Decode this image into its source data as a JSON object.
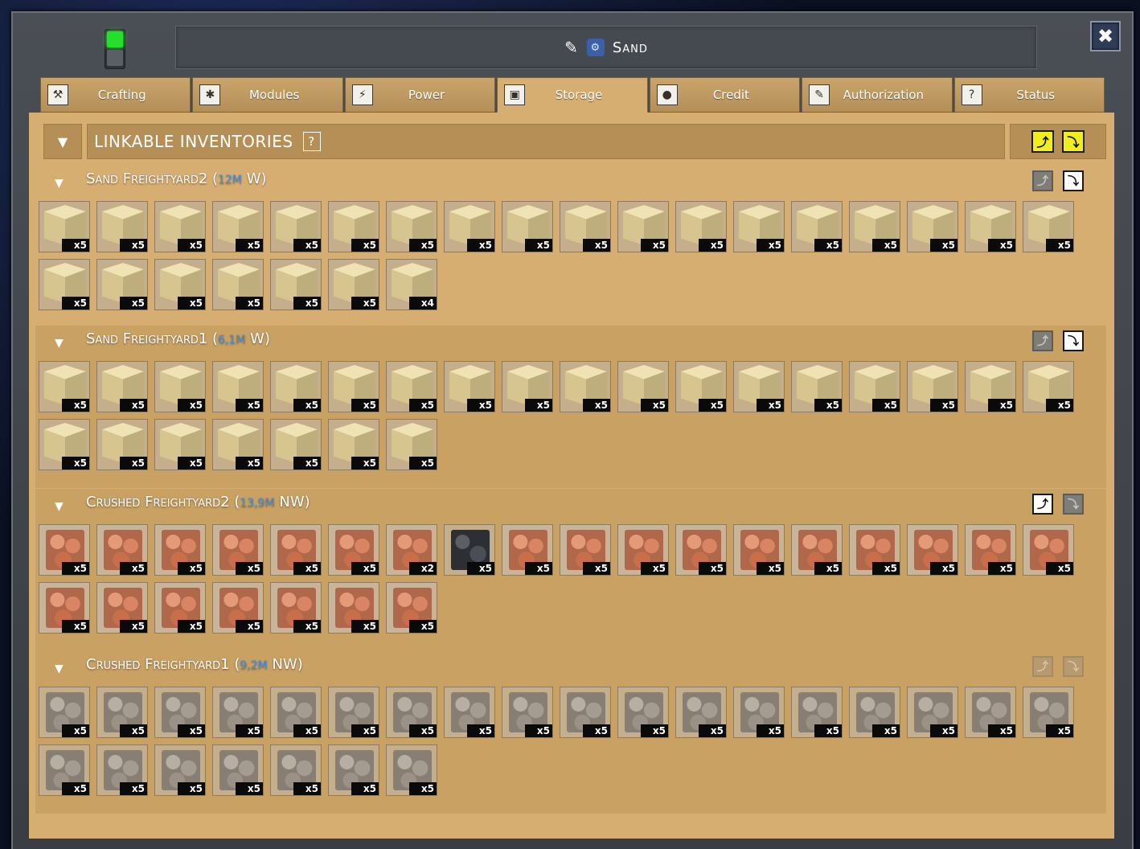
{
  "window": {
    "title": "Sand",
    "close_label": "✖"
  },
  "tabs": [
    {
      "label": "Crafting",
      "icon": "crafting-icon",
      "active": false
    },
    {
      "label": "Modules",
      "icon": "modules-icon",
      "active": false
    },
    {
      "label": "Power",
      "icon": "power-icon",
      "active": false
    },
    {
      "label": "Storage",
      "icon": "storage-icon",
      "active": true
    },
    {
      "label": "Credit",
      "icon": "credit-icon",
      "active": false
    },
    {
      "label": "Authorization",
      "icon": "authorization-icon",
      "active": false
    },
    {
      "label": "Status",
      "icon": "status-icon",
      "active": false
    }
  ],
  "linkable": {
    "title": "LINKABLE INVENTORIES",
    "help": "?"
  },
  "inventories": [
    {
      "name": "Sand Freightyard2",
      "distance": "12M",
      "direction": "W",
      "push_state": "off",
      "pull_state": "on",
      "items": [
        {
          "type": "sand",
          "count": "x5"
        },
        {
          "type": "sand",
          "count": "x5"
        },
        {
          "type": "sand",
          "count": "x5"
        },
        {
          "type": "sand",
          "count": "x5"
        },
        {
          "type": "sand",
          "count": "x5"
        },
        {
          "type": "sand",
          "count": "x5"
        },
        {
          "type": "sand",
          "count": "x5"
        },
        {
          "type": "sand",
          "count": "x5"
        },
        {
          "type": "sand",
          "count": "x5"
        },
        {
          "type": "sand",
          "count": "x5"
        },
        {
          "type": "sand",
          "count": "x5"
        },
        {
          "type": "sand",
          "count": "x5"
        },
        {
          "type": "sand",
          "count": "x5"
        },
        {
          "type": "sand",
          "count": "x5"
        },
        {
          "type": "sand",
          "count": "x5"
        },
        {
          "type": "sand",
          "count": "x5"
        },
        {
          "type": "sand",
          "count": "x5"
        },
        {
          "type": "sand",
          "count": "x5"
        },
        {
          "type": "sand",
          "count": "x5"
        },
        {
          "type": "sand",
          "count": "x5"
        },
        {
          "type": "sand",
          "count": "x5"
        },
        {
          "type": "sand",
          "count": "x5"
        },
        {
          "type": "sand",
          "count": "x5"
        },
        {
          "type": "sand",
          "count": "x5"
        },
        {
          "type": "sand",
          "count": "x4"
        }
      ]
    },
    {
      "name": "Sand Freightyard1",
      "distance": "6,1M",
      "direction": "W",
      "push_state": "off",
      "pull_state": "on",
      "items": [
        {
          "type": "sand",
          "count": "x5"
        },
        {
          "type": "sand",
          "count": "x5"
        },
        {
          "type": "sand",
          "count": "x5"
        },
        {
          "type": "sand",
          "count": "x5"
        },
        {
          "type": "sand",
          "count": "x5"
        },
        {
          "type": "sand",
          "count": "x5"
        },
        {
          "type": "sand",
          "count": "x5"
        },
        {
          "type": "sand",
          "count": "x5"
        },
        {
          "type": "sand",
          "count": "x5"
        },
        {
          "type": "sand",
          "count": "x5"
        },
        {
          "type": "sand",
          "count": "x5"
        },
        {
          "type": "sand",
          "count": "x5"
        },
        {
          "type": "sand",
          "count": "x5"
        },
        {
          "type": "sand",
          "count": "x5"
        },
        {
          "type": "sand",
          "count": "x5"
        },
        {
          "type": "sand",
          "count": "x5"
        },
        {
          "type": "sand",
          "count": "x5"
        },
        {
          "type": "sand",
          "count": "x5"
        },
        {
          "type": "sand",
          "count": "x5"
        },
        {
          "type": "sand",
          "count": "x5"
        },
        {
          "type": "sand",
          "count": "x5"
        },
        {
          "type": "sand",
          "count": "x5"
        },
        {
          "type": "sand",
          "count": "x5"
        },
        {
          "type": "sand",
          "count": "x5"
        },
        {
          "type": "sand",
          "count": "x5"
        }
      ]
    },
    {
      "name": "Crushed Freightyard2",
      "distance": "13,9M",
      "direction": "NW",
      "push_state": "on",
      "pull_state": "off",
      "items": [
        {
          "type": "copper",
          "count": "x5"
        },
        {
          "type": "copper",
          "count": "x5"
        },
        {
          "type": "copper",
          "count": "x5"
        },
        {
          "type": "copper",
          "count": "x5"
        },
        {
          "type": "copper",
          "count": "x5"
        },
        {
          "type": "copper",
          "count": "x5"
        },
        {
          "type": "copper",
          "count": "x2"
        },
        {
          "type": "dark",
          "count": "x5"
        },
        {
          "type": "copper",
          "count": "x5"
        },
        {
          "type": "copper",
          "count": "x5"
        },
        {
          "type": "copper",
          "count": "x5"
        },
        {
          "type": "copper",
          "count": "x5"
        },
        {
          "type": "copper",
          "count": "x5"
        },
        {
          "type": "copper",
          "count": "x5"
        },
        {
          "type": "copper",
          "count": "x5"
        },
        {
          "type": "copper",
          "count": "x5"
        },
        {
          "type": "copper",
          "count": "x5"
        },
        {
          "type": "copper",
          "count": "x5"
        },
        {
          "type": "copper",
          "count": "x5"
        },
        {
          "type": "copper",
          "count": "x5"
        },
        {
          "type": "copper",
          "count": "x5"
        },
        {
          "type": "copper",
          "count": "x5"
        },
        {
          "type": "copper",
          "count": "x5"
        },
        {
          "type": "copper",
          "count": "x5"
        },
        {
          "type": "copper",
          "count": "x5"
        }
      ]
    },
    {
      "name": "Crushed Freightyard1",
      "distance": "9,2M",
      "direction": "NW",
      "push_state": "faded",
      "pull_state": "faded",
      "items": [
        {
          "type": "grey",
          "count": "x5"
        },
        {
          "type": "grey",
          "count": "x5"
        },
        {
          "type": "grey",
          "count": "x5"
        },
        {
          "type": "grey",
          "count": "x5"
        },
        {
          "type": "grey",
          "count": "x5"
        },
        {
          "type": "grey",
          "count": "x5"
        },
        {
          "type": "grey",
          "count": "x5"
        },
        {
          "type": "grey",
          "count": "x5"
        },
        {
          "type": "grey",
          "count": "x5"
        },
        {
          "type": "grey",
          "count": "x5"
        },
        {
          "type": "grey",
          "count": "x5"
        },
        {
          "type": "grey",
          "count": "x5"
        },
        {
          "type": "grey",
          "count": "x5"
        },
        {
          "type": "grey",
          "count": "x5"
        },
        {
          "type": "grey",
          "count": "x5"
        },
        {
          "type": "grey",
          "count": "x5"
        },
        {
          "type": "grey",
          "count": "x5"
        },
        {
          "type": "grey",
          "count": "x5"
        },
        {
          "type": "grey",
          "count": "x5"
        },
        {
          "type": "grey",
          "count": "x5"
        },
        {
          "type": "grey",
          "count": "x5"
        },
        {
          "type": "grey",
          "count": "x5"
        },
        {
          "type": "grey",
          "count": "x5"
        },
        {
          "type": "grey",
          "count": "x5"
        },
        {
          "type": "grey",
          "count": "x5"
        }
      ]
    }
  ],
  "colors": {
    "panel": "#d7ae72",
    "distance": "#3a8ee8",
    "power_on": "#24e02a"
  }
}
